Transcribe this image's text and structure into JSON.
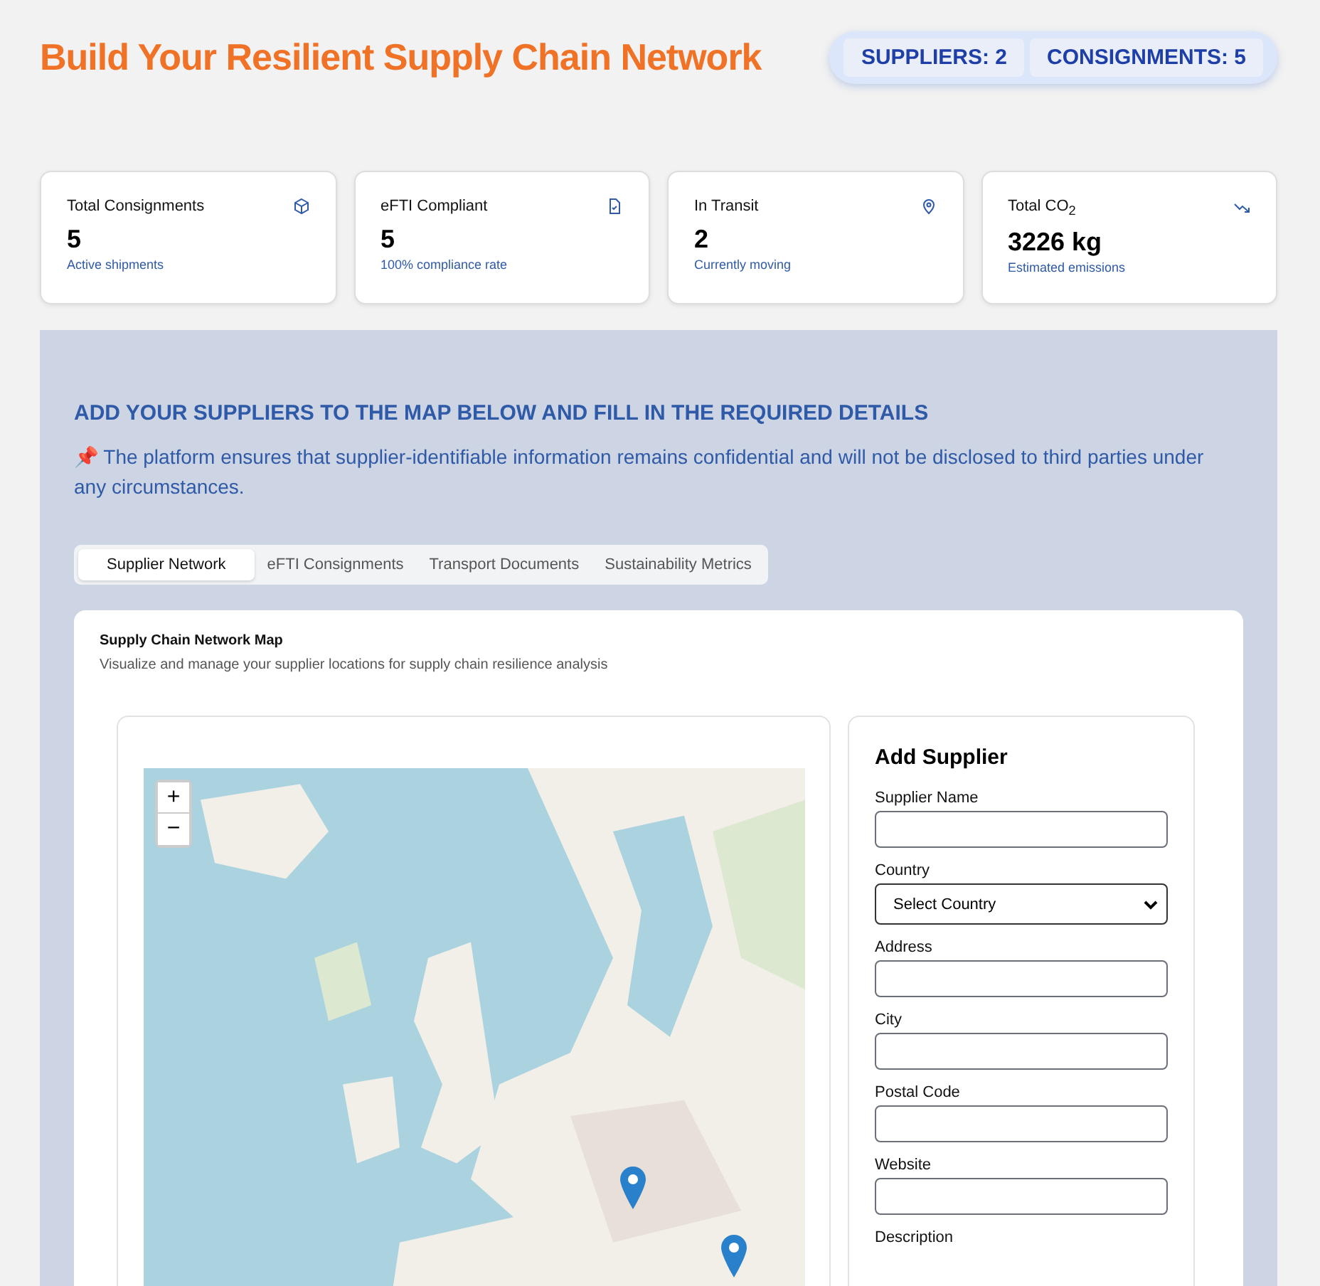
{
  "header": {
    "title": "Build Your Resilient Supply Chain Network",
    "badges": [
      "SUPPLIERS: 2",
      "CONSIGNMENTS: 5"
    ]
  },
  "stats": [
    {
      "label": "Total Consignments",
      "value": "5",
      "note": "Active shipments",
      "kind": "box"
    },
    {
      "label": "eFTI Compliant",
      "value": "5",
      "note": "100% compliance rate",
      "kind": "document"
    },
    {
      "label": "In Transit",
      "value": "2",
      "note": "Currently moving",
      "kind": "pin"
    },
    {
      "label": "Total CO$_{2}$",
      "value": "3226 kg",
      "note": "Estimated emissions",
      "kind": "trend"
    }
  ],
  "section": {
    "heading": "ADD YOUR SUPPLIERS TO THE MAP BELOW AND FILL IN THE REQUIRED DETAILS",
    "notice": "📌 The platform ensures that supplier-identifiable information remains confidential and will not be disclosed to third parties under any circumstances."
  },
  "tabs": [
    {
      "label": "Supplier Network",
      "selected": true
    },
    {
      "label": "eFTI Consignments",
      "selected": false
    },
    {
      "label": "Transport Documents",
      "selected": false
    },
    {
      "label": "Sustainability Metrics",
      "selected": false
    }
  ],
  "map_card": {
    "title": "Supply Chain Network Map",
    "subtitle": "Visualize and manage your supplier locations for supply chain resilience analysis",
    "zoom_in": "+",
    "zoom_out": "−"
  },
  "form": {
    "title": "Add Supplier",
    "fields": [
      {
        "label": "Supplier Name",
        "kind": "input"
      },
      {
        "label": "Country",
        "kind": "select",
        "value": "Select Country"
      },
      {
        "label": "Address",
        "kind": "input"
      },
      {
        "label": "City",
        "kind": "input"
      },
      {
        "label": "Postal Code",
        "kind": "input"
      },
      {
        "label": "Website",
        "kind": "input"
      },
      {
        "label": "Description",
        "kind": "label"
      }
    ]
  }
}
